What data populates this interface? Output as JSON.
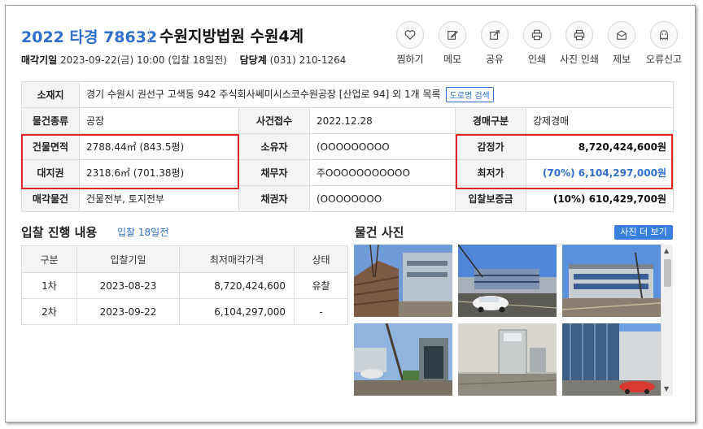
{
  "header": {
    "case_no": "2022 타경 78632",
    "court": "수원지방법원 수원4계",
    "sale_date_label": "매각기일",
    "sale_date": "2023-09-22(금) 10:00 (입찰 18일전)",
    "dept_label": "담당계",
    "dept_phone": "(031) 210-1264"
  },
  "actions": [
    {
      "label": "찜하기",
      "icon": "heart-icon"
    },
    {
      "label": "메모",
      "icon": "pencil-icon"
    },
    {
      "label": "공유",
      "icon": "share-icon"
    },
    {
      "label": "인쇄",
      "icon": "printer-icon"
    },
    {
      "label": "사진 인쇄",
      "icon": "printer-icon"
    },
    {
      "label": "제보",
      "icon": "mail-icon"
    },
    {
      "label": "오류신고",
      "icon": "ghost-icon"
    }
  ],
  "info": {
    "location_label": "소재지",
    "location": "경기 수원시 권선구 고색동 942 주식회사쎄미시스코수원공장 [산업로 94] 외 1개 목록",
    "road_btn": "도로명 검색",
    "type_label": "물건종류",
    "type": "공장",
    "receipt_label": "사건접수",
    "receipt": "2022.12.28",
    "auction_type_label": "경매구분",
    "auction_type": "강제경매",
    "building_area_label": "건물면적",
    "building_area": "2788.44㎡ (843.5평)",
    "owner_label": "소유자",
    "owner": "(OOOOOOOOO",
    "appraisal_label": "감정가",
    "appraisal": "8,720,424,600원",
    "land_label": "대지권",
    "land": "2318.6㎡ (701.38평)",
    "debtor_label": "채무자",
    "debtor": "주OOOOOOOOOOO",
    "min_price_label": "최저가",
    "min_price": "(70%) 6,104,297,000원",
    "sale_obj_label": "매각물건",
    "sale_obj": "건물전부, 토지전부",
    "creditor_label": "채권자",
    "creditor": "(OOOOOOOO",
    "deposit_label": "입찰보증금",
    "deposit": "(10%) 610,429,700원"
  },
  "progress": {
    "title": "입찰 진행 내용",
    "sub": "입찰 18일전",
    "columns": [
      "구분",
      "입찰기일",
      "최저매각가격",
      "상태"
    ],
    "rows": [
      [
        "1차",
        "2023-08-23",
        "8,720,424,600",
        "유찰"
      ],
      [
        "2차",
        "2023-09-22",
        "6,104,297,000",
        "-"
      ]
    ]
  },
  "photos": {
    "title": "물건 사진",
    "more_btn": "사진 더 보기",
    "count": 6
  },
  "colors": {
    "accent": "#2f6fc9",
    "highlight": "#e02424",
    "header_bg": "#f3f4f6"
  }
}
